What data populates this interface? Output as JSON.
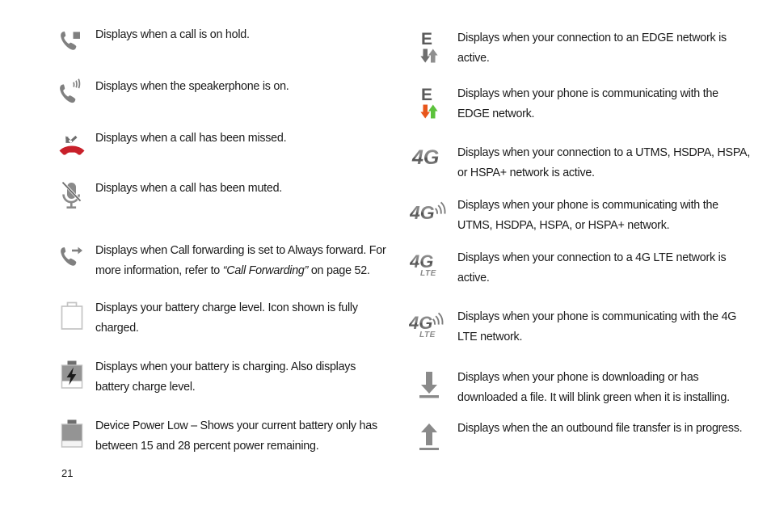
{
  "page": {
    "number": "21",
    "background": "#ffffff",
    "text_color": "#1a1a1a"
  },
  "colors": {
    "icon_gray": "#808080",
    "icon_dark_gray": "#5a5a5a",
    "icon_light_gray": "#9a9a9a",
    "missed_call_red": "#c8202a",
    "arrow_orange": "#e8561b",
    "arrow_green": "#5cc23c",
    "battery_outline": "#c9c9c9",
    "battery_fill": "#949494",
    "bolt_black": "#1a1a1a"
  },
  "left_column": [
    {
      "icon": "phone-hold-icon",
      "description": "Displays when a call is on hold."
    },
    {
      "icon": "phone-speaker-icon",
      "description": "Displays when the speakerphone is on."
    },
    {
      "icon": "missed-call-icon",
      "description": "Displays when a call has been missed."
    },
    {
      "icon": "microphone-muted-icon",
      "description": "Displays when a call has been muted."
    },
    {
      "icon": "call-forwarding-icon",
      "description_part1": "Displays when Call forwarding is set to Always forward. For more information, refer to ",
      "description_italic": "“Call Forwarding”",
      "description_part2": " on page 52."
    },
    {
      "icon": "battery-full-icon",
      "description": "Displays your battery charge level. Icon shown is fully charged."
    },
    {
      "icon": "battery-charging-icon",
      "description": "Displays when your battery is charging. Also displays battery charge level."
    },
    {
      "icon": "battery-low-icon",
      "description": "Device Power Low – Shows your current battery only has between 15 and 28 percent power remaining."
    }
  ],
  "right_column": [
    {
      "icon": "edge-network-icon",
      "description": "Displays when your connection to an EDGE network is active."
    },
    {
      "icon": "edge-network-active-icon",
      "description": "Displays when your phone is communicating with the EDGE network."
    },
    {
      "icon": "4g-icon",
      "description": "Displays when your connection to a UTMS, HSDPA, HSPA, or HSPA+ network is active."
    },
    {
      "icon": "4g-signal-icon",
      "description": "Displays when your phone is communicating with the UTMS, HSDPA, HSPA, or HSPA+ network."
    },
    {
      "icon": "4g-lte-icon",
      "description": "Displays when your connection to a 4G LTE network is active."
    },
    {
      "icon": "4g-lte-signal-icon",
      "description": "Displays when your phone is communicating with the 4G LTE network."
    },
    {
      "icon": "download-icon",
      "description": "Displays when your phone is downloading or has downloaded a file. It will blink green when it is installing."
    },
    {
      "icon": "upload-icon",
      "description": "Displays when the an outbound file transfer is in progress."
    }
  ],
  "icon_labels": {
    "edge_letter": "E",
    "four_g": "4G",
    "lte": "LTE"
  }
}
